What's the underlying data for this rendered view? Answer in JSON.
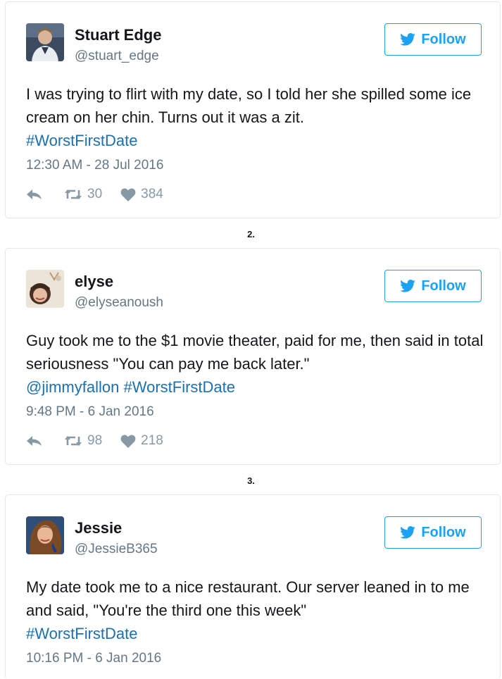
{
  "separators": [
    "2.",
    "3."
  ],
  "follow_label": "Follow",
  "colors": {
    "accent": "#1da1f2",
    "link": "#1b6fb3",
    "muted": "#657786",
    "icon": "#8899a6"
  },
  "tweets": [
    {
      "name": "Stuart Edge",
      "handle": "@stuart_edge",
      "text_parts": [
        "I was trying to flirt with my date, so I told her she spilled some ice cream on her chin. Turns out it was a zit.",
        "#WorstFirstDate"
      ],
      "timestamp": "12:30 AM - 28 Jul 2016",
      "retweets": "30",
      "likes": "384"
    },
    {
      "name": "elyse",
      "handle": "@elyseanoush",
      "text_parts": [
        "Guy took me to the $1 movie theater, paid for me, then said in total seriousness \"You can pay me back later.\"",
        "@jimmyfallon",
        "#WorstFirstDate"
      ],
      "timestamp": "9:48 PM - 6 Jan 2016",
      "retweets": "98",
      "likes": "218"
    },
    {
      "name": "Jessie",
      "handle": "@JessieB365",
      "text_parts": [
        "My date took me to a nice restaurant. Our server leaned in to me and said, \"You're the third one this week\"",
        "#WorstFirstDate"
      ],
      "timestamp": "10:16 PM - 6 Jan 2016"
    }
  ]
}
